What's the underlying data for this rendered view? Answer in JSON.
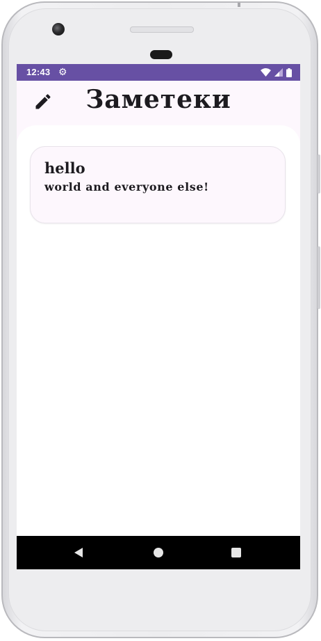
{
  "status_bar": {
    "time": "12:43",
    "color": "#6750a4",
    "icons": [
      "settings-icon",
      "wifi-icon",
      "signal-icon",
      "battery-icon"
    ]
  },
  "app_bar": {
    "title": "Заметеки",
    "leading_icon": "edit-icon"
  },
  "notes": [
    {
      "title": "hello",
      "body": "world and everyone else!"
    }
  ],
  "fab": {
    "label": "+",
    "icon": "add-icon",
    "color": "#eaddff"
  },
  "nav_bar": {
    "icons": [
      "back-icon",
      "home-icon",
      "recents-icon"
    ]
  }
}
